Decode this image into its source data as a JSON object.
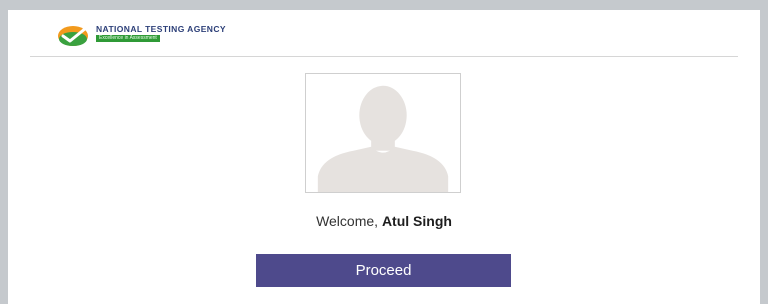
{
  "header": {
    "logo_icon": "nta-logo-icon",
    "org_name": "NATIONAL TESTING AGENCY",
    "tagline": "Excellence in Assessment"
  },
  "profile": {
    "photo_icon": "user-silhouette-icon"
  },
  "welcome": {
    "greeting": "Welcome,",
    "user_name": "Atul Singh"
  },
  "actions": {
    "proceed_label": "Proceed"
  },
  "colors": {
    "page_bg": "#c5c9cd",
    "brand_navy": "#2c3f78",
    "tagline_green": "#2f9a36",
    "button_bg": "#4e4a8c",
    "logo_orange": "#f29a1d",
    "logo_green": "#3aa13f"
  }
}
